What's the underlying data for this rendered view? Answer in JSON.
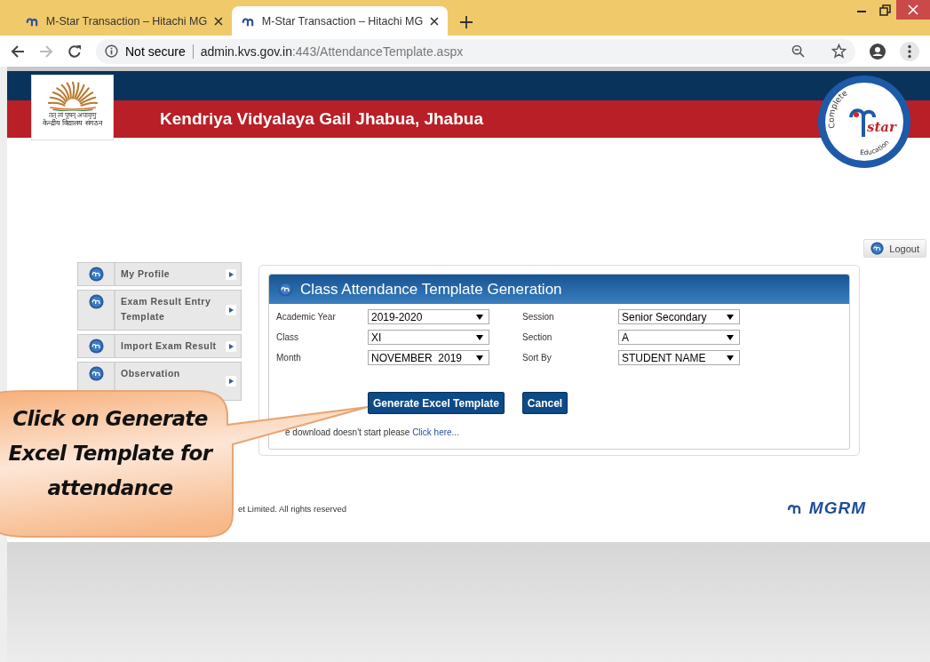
{
  "browser": {
    "tabs": [
      {
        "title": "M-Star Transaction – Hitachi MG",
        "selected": false
      },
      {
        "title": "M-Star Transaction – Hitachi MG",
        "selected": true
      }
    ],
    "security": "Not secure",
    "url_host": "admin.kvs.gov.in",
    "url_path": ":443/AttendanceTemplate.aspx"
  },
  "header": {
    "logo_motto": "तत् त्वं पूषन् अपावृणु",
    "logo_name": "केन्द्रीय विद्यालय संगठन",
    "title": "Kendriya Vidyalaya Gail Jhabua, Jhabua",
    "badge_top": "Complete",
    "badge_mid": "star",
    "badge_bottom": "Education"
  },
  "logout": "Logout",
  "sidebar": {
    "items": [
      {
        "label": "My Profile"
      },
      {
        "label": "Exam Result Entry Template"
      },
      {
        "label": "Import Exam Result"
      },
      {
        "label": "Observation"
      }
    ]
  },
  "form": {
    "title": "Class Attendance Template Generation",
    "fields": [
      {
        "label": "Academic Year",
        "value": "2019-2020"
      },
      {
        "label": "Session",
        "value": "Senior Secondary"
      },
      {
        "label": "Class",
        "value": "XI"
      },
      {
        "label": "Section",
        "value": "A"
      },
      {
        "label": "Month",
        "value": "NOVEMBER  2019"
      },
      {
        "label": "Sort By",
        "value": "STUDENT NAME"
      }
    ],
    "buttons": [
      "Generate Excel Template",
      "Cancel"
    ],
    "note": "e download doesn't start please",
    "note_link": "Click here..."
  },
  "footer": {
    "copyright": "et Limited. All rights reserved",
    "brand": "MGRM"
  },
  "callout": {
    "text": "Click on Generate\nExcel Template for\nattendance"
  }
}
